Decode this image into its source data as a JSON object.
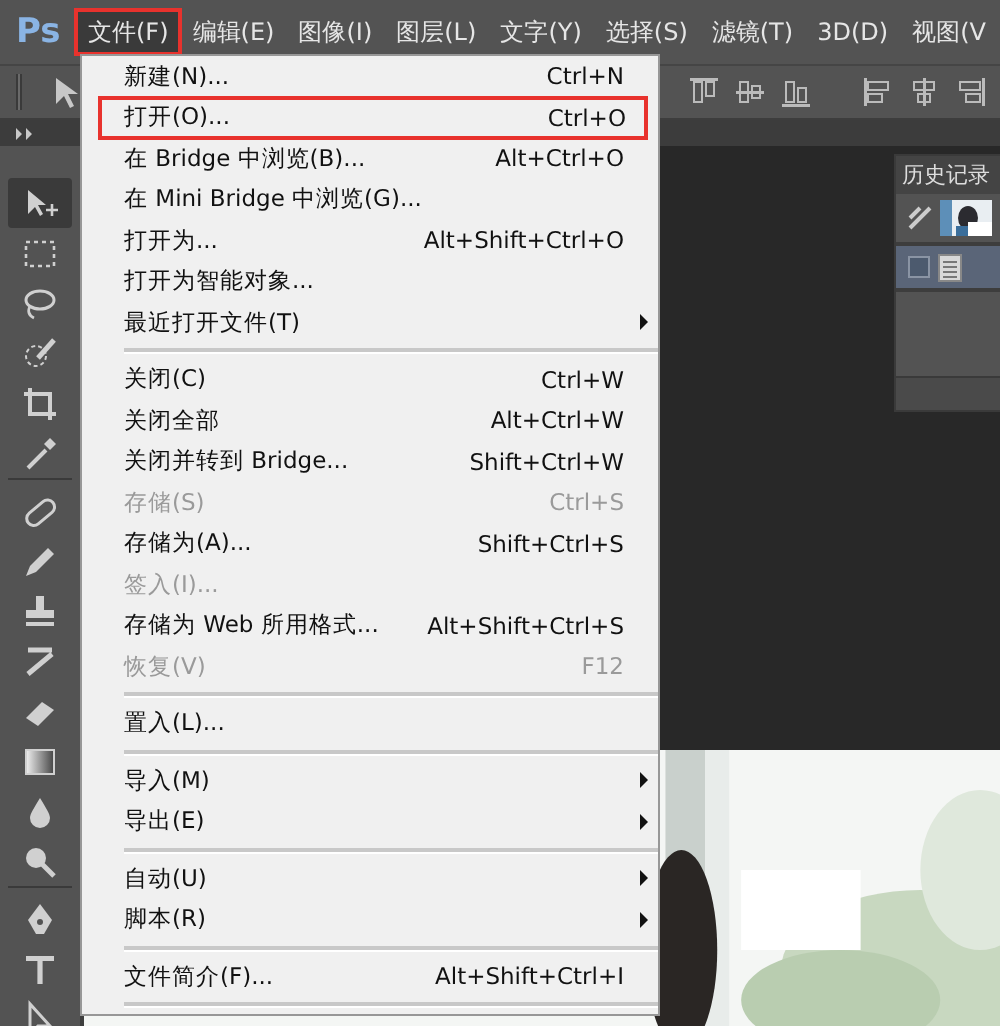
{
  "app": {
    "logo": "Ps"
  },
  "menubar": [
    {
      "label": "文件(F)",
      "selected": true,
      "highlighted": true
    },
    {
      "label": "编辑(E)",
      "selected": false,
      "highlighted": false
    },
    {
      "label": "图像(I)",
      "selected": false,
      "highlighted": false
    },
    {
      "label": "图层(L)",
      "selected": false,
      "highlighted": false
    },
    {
      "label": "文字(Y)",
      "selected": false,
      "highlighted": false
    },
    {
      "label": "选择(S)",
      "selected": false,
      "highlighted": false
    },
    {
      "label": "滤镜(T)",
      "selected": false,
      "highlighted": false
    },
    {
      "label": "3D(D)",
      "selected": false,
      "highlighted": false
    },
    {
      "label": "视图(V",
      "selected": false,
      "highlighted": false
    }
  ],
  "file_menu": [
    {
      "kind": "item",
      "label": "新建(N)...",
      "shortcut": "Ctrl+N",
      "disabled": false,
      "submenu": false,
      "highlighted": false
    },
    {
      "kind": "item",
      "label": "打开(O)...",
      "shortcut": "Ctrl+O",
      "disabled": false,
      "submenu": false,
      "highlighted": true
    },
    {
      "kind": "item",
      "label": "在 Bridge 中浏览(B)...",
      "shortcut": "Alt+Ctrl+O",
      "disabled": false,
      "submenu": false,
      "highlighted": false
    },
    {
      "kind": "item",
      "label": "在 Mini Bridge 中浏览(G)...",
      "disabled": false,
      "submenu": false,
      "highlighted": false
    },
    {
      "kind": "item",
      "label": "打开为...",
      "shortcut": "Alt+Shift+Ctrl+O",
      "disabled": false,
      "submenu": false,
      "highlighted": false
    },
    {
      "kind": "item",
      "label": "打开为智能对象...",
      "disabled": false,
      "submenu": false,
      "highlighted": false
    },
    {
      "kind": "item",
      "label": "最近打开文件(T)",
      "disabled": false,
      "submenu": true,
      "highlighted": false
    },
    {
      "kind": "separator"
    },
    {
      "kind": "item",
      "label": "关闭(C)",
      "shortcut": "Ctrl+W",
      "disabled": false,
      "submenu": false,
      "highlighted": false
    },
    {
      "kind": "item",
      "label": "关闭全部",
      "shortcut": "Alt+Ctrl+W",
      "disabled": false,
      "submenu": false,
      "highlighted": false
    },
    {
      "kind": "item",
      "label": "关闭并转到 Bridge...",
      "shortcut": "Shift+Ctrl+W",
      "disabled": false,
      "submenu": false,
      "highlighted": false
    },
    {
      "kind": "item",
      "label": "存储(S)",
      "shortcut": "Ctrl+S",
      "disabled": true,
      "submenu": false,
      "highlighted": false
    },
    {
      "kind": "item",
      "label": "存储为(A)...",
      "shortcut": "Shift+Ctrl+S",
      "disabled": false,
      "submenu": false,
      "highlighted": false
    },
    {
      "kind": "item",
      "label": "签入(I)...",
      "disabled": true,
      "submenu": false,
      "highlighted": false
    },
    {
      "kind": "item",
      "label": "存储为 Web 所用格式...",
      "shortcut": "Alt+Shift+Ctrl+S",
      "disabled": false,
      "submenu": false,
      "highlighted": false
    },
    {
      "kind": "item",
      "label": "恢复(V)",
      "shortcut": "F12",
      "disabled": true,
      "submenu": false,
      "highlighted": false
    },
    {
      "kind": "separator"
    },
    {
      "kind": "item",
      "label": "置入(L)...",
      "disabled": false,
      "submenu": false,
      "highlighted": false
    },
    {
      "kind": "separator"
    },
    {
      "kind": "item",
      "label": "导入(M)",
      "disabled": false,
      "submenu": true,
      "highlighted": false
    },
    {
      "kind": "item",
      "label": "导出(E)",
      "disabled": false,
      "submenu": true,
      "highlighted": false
    },
    {
      "kind": "separator"
    },
    {
      "kind": "item",
      "label": "自动(U)",
      "disabled": false,
      "submenu": true,
      "highlighted": false
    },
    {
      "kind": "item",
      "label": "脚本(R)",
      "disabled": false,
      "submenu": true,
      "highlighted": false
    },
    {
      "kind": "separator"
    },
    {
      "kind": "item",
      "label": "文件简介(F)...",
      "shortcut": "Alt+Shift+Ctrl+I",
      "disabled": false,
      "submenu": false,
      "highlighted": false
    },
    {
      "kind": "separator"
    }
  ],
  "history_panel": {
    "title": "历史记录",
    "rows": [
      {
        "kind": "snapshot",
        "selected": false
      },
      {
        "kind": "state",
        "selected": true
      }
    ]
  }
}
